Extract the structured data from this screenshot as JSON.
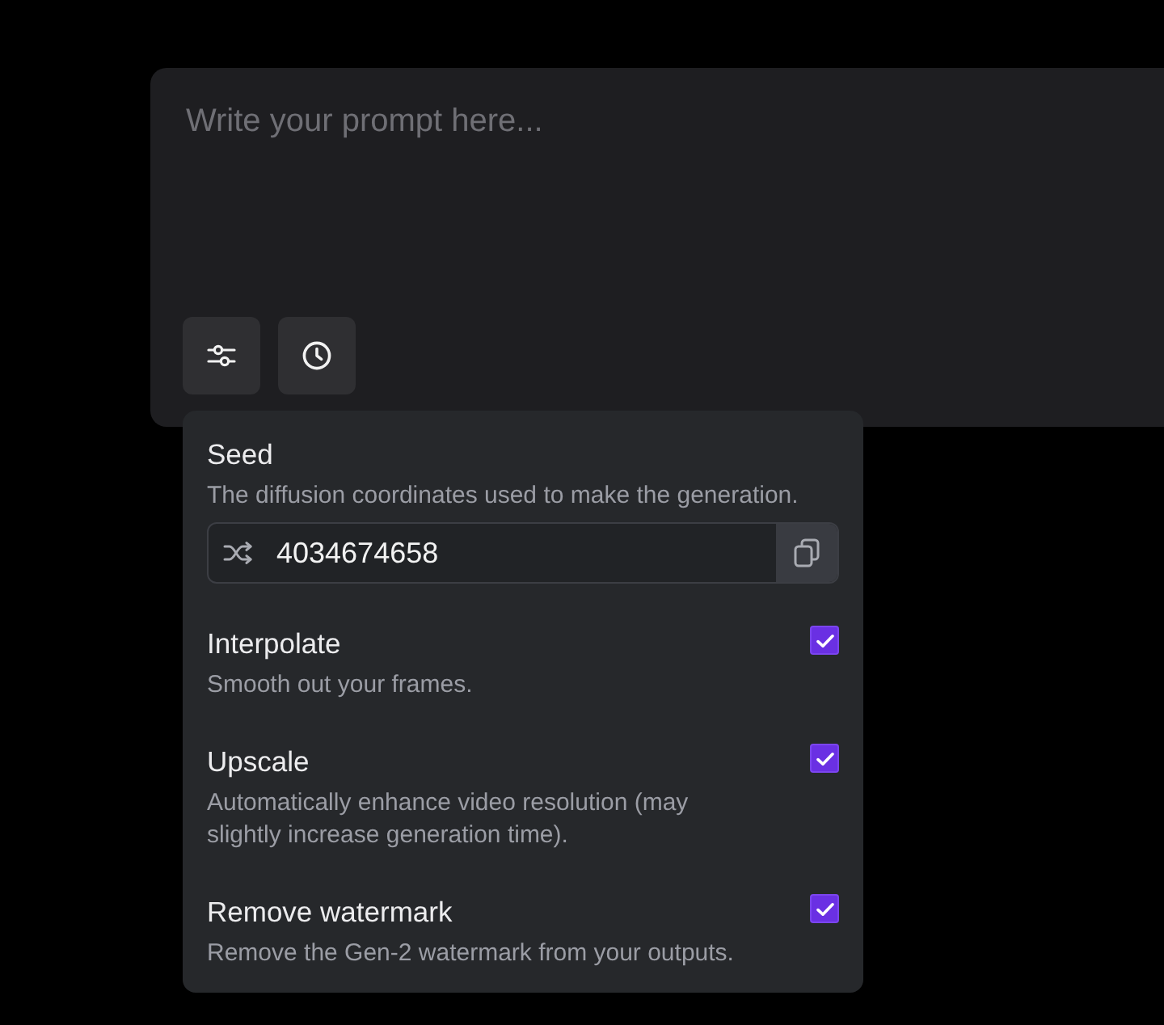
{
  "prompt": {
    "placeholder": "Write your prompt here..."
  },
  "toolbar": [
    {
      "kind": "settings"
    },
    {
      "kind": "history"
    }
  ],
  "settings_popover": {
    "seed": {
      "label": "Seed",
      "description": "The diffusion coordinates used to make the generation.",
      "value": "4034674658"
    },
    "options": [
      {
        "label": "Interpolate",
        "description": "Smooth out your frames.",
        "checked": true
      },
      {
        "label": "Upscale",
        "description": "Automatically enhance video resolution (may slightly increase generation time).",
        "checked": true
      },
      {
        "label": "Remove watermark",
        "description": "Remove the Gen-2 watermark from your outputs.",
        "checked": true
      }
    ]
  }
}
